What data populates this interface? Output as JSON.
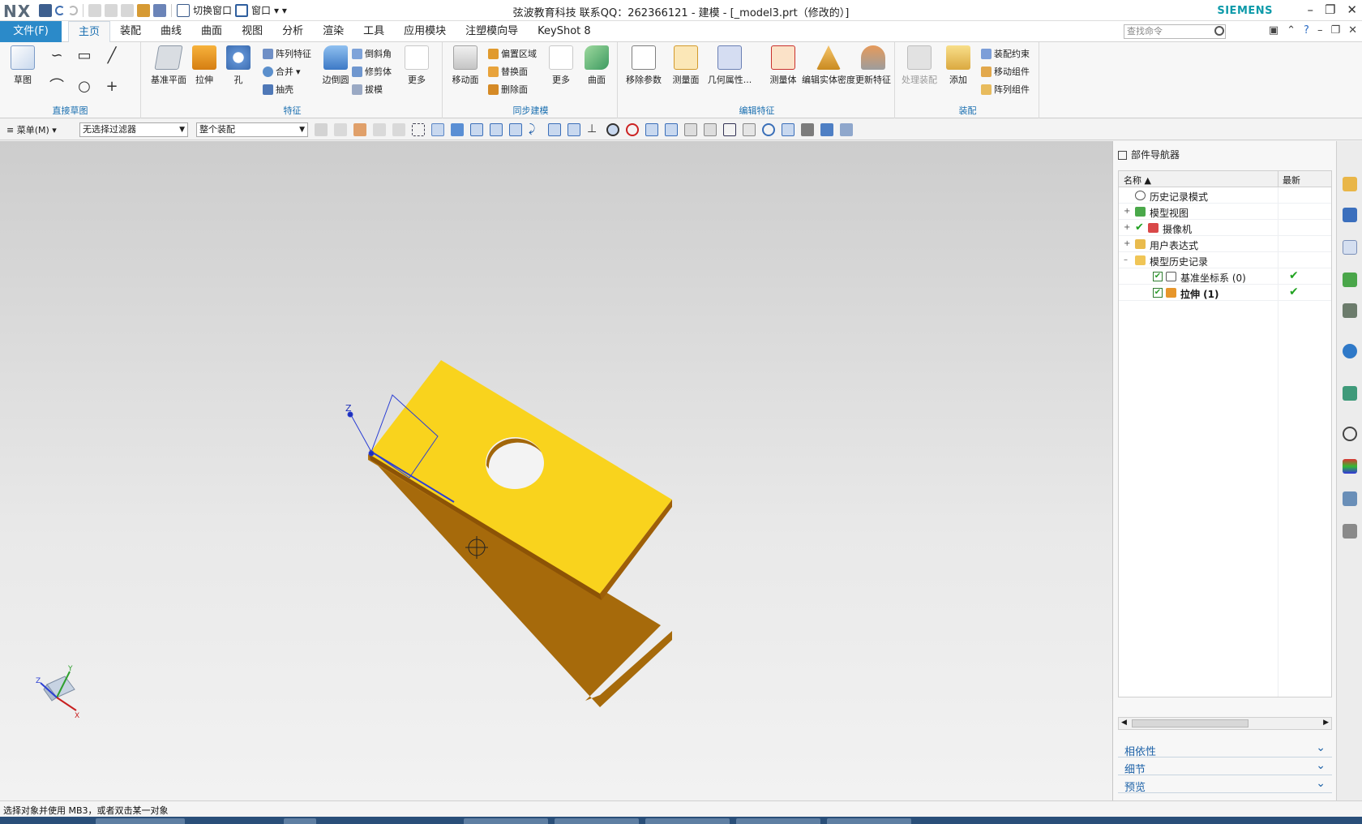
{
  "app": {
    "logo": "NX",
    "title": "弦波教育科技 联系QQ：262366121 - 建模 - [_model3.prt（修改的）]",
    "brand": "SIEMENS",
    "switch_window": "切换窗口",
    "window": "窗口"
  },
  "menu": {
    "file": "文件(F)",
    "tabs": [
      "主页",
      "装配",
      "曲线",
      "曲面",
      "视图",
      "分析",
      "渲染",
      "工具",
      "应用模块",
      "注塑模向导",
      "KeyShot 8"
    ],
    "active_tab": "主页",
    "search_placeholder": "查找命令"
  },
  "ribbon": {
    "sketch_group": {
      "label": "直接草图",
      "sketch": "草图"
    },
    "feature_group": {
      "label": "特征",
      "datum_plane": "基准平面",
      "extrude": "拉伸",
      "hole": "孔",
      "pattern_feature": "阵列特征",
      "unite": "合并",
      "shell": "抽壳",
      "edge_blend": "边倒圆",
      "chamfer": "倒斜角",
      "trim_body": "修剪体",
      "draft": "拔模",
      "more": "更多"
    },
    "sync_group": {
      "label": "同步建模",
      "move_face": "移动面",
      "offset_region": "偏置区域",
      "replace_face": "替换面",
      "delete_face": "删除面",
      "more": "更多",
      "surface": "曲面"
    },
    "edit_group": {
      "label": "编辑特征",
      "remove_params": "移除参数",
      "measure_face": "测量面",
      "geometric_props": "几何属性...",
      "measure_body": "测量体",
      "edit_density": "编辑实体密度",
      "update_feature": "更新特征"
    },
    "assembly_group": {
      "label": "装配",
      "process_assembly": "处理装配",
      "add": "添加",
      "constraints": "装配约束",
      "move_component": "移动组件",
      "pattern_component": "阵列组件"
    }
  },
  "selection_bar": {
    "menu": "菜单(M)",
    "filter": "无选择过滤器",
    "scope": "整个装配"
  },
  "navigator": {
    "title": "部件导航器",
    "col_name": "名称",
    "col_latest": "最新",
    "rows": [
      {
        "label": "历史记录模式",
        "icon": "clock-icon"
      },
      {
        "label": "模型视图",
        "icon": "views-icon"
      },
      {
        "label": "摄像机",
        "icon": "camera-icon"
      },
      {
        "label": "用户表达式",
        "icon": "folder-icon"
      },
      {
        "label": "模型历史记录",
        "icon": "folder-icon"
      },
      {
        "label": "基准坐标系 (0)",
        "icon": "datum-csys-icon",
        "latest": "✔"
      },
      {
        "label": "拉伸 (1)",
        "icon": "extrude-icon",
        "latest": "✔"
      }
    ],
    "panels": [
      "相依性",
      "细节",
      "预览"
    ]
  },
  "status": {
    "prompt": "选择对象并使用 MB3，或者双击某一对象"
  },
  "model": {
    "part_color": "#f9d31d",
    "side_color": "#a66a0b",
    "accent": "#2b8ac9"
  }
}
